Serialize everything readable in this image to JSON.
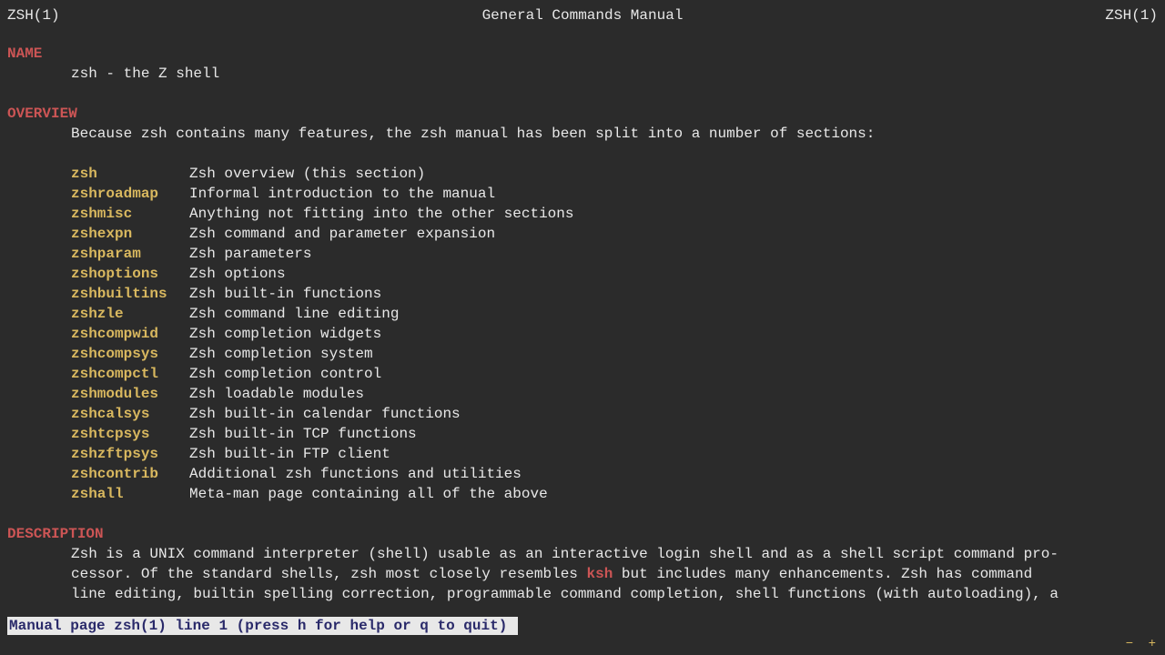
{
  "header": {
    "left": "ZSH(1)",
    "center": "General Commands Manual",
    "right": "ZSH(1)"
  },
  "name_section": {
    "header": "NAME",
    "line": "zsh - the Z shell"
  },
  "overview_section": {
    "header": "OVERVIEW",
    "intro": "Because zsh contains many features, the zsh manual has been split into a number of sections:",
    "items": [
      {
        "name": "zsh",
        "desc": "Zsh overview (this section)"
      },
      {
        "name": "zshroadmap",
        "desc": "Informal introduction to the manual"
      },
      {
        "name": "zshmisc",
        "desc": "Anything not fitting into the other sections"
      },
      {
        "name": "zshexpn",
        "desc": "Zsh command and parameter expansion"
      },
      {
        "name": "zshparam",
        "desc": "Zsh parameters"
      },
      {
        "name": "zshoptions",
        "desc": "Zsh options"
      },
      {
        "name": "zshbuiltins",
        "desc": "Zsh built-in functions"
      },
      {
        "name": "zshzle",
        "desc": "Zsh command line editing"
      },
      {
        "name": "zshcompwid",
        "desc": "Zsh completion widgets"
      },
      {
        "name": "zshcompsys",
        "desc": "Zsh completion system"
      },
      {
        "name": "zshcompctl",
        "desc": "Zsh completion control"
      },
      {
        "name": "zshmodules",
        "desc": "Zsh loadable modules"
      },
      {
        "name": "zshcalsys",
        "desc": "Zsh built-in calendar functions"
      },
      {
        "name": "zshtcpsys",
        "desc": "Zsh built-in TCP functions"
      },
      {
        "name": "zshzftpsys",
        "desc": "Zsh built-in FTP client"
      },
      {
        "name": "zshcontrib",
        "desc": "Additional zsh functions and utilities"
      },
      {
        "name": "zshall",
        "desc": "Meta-man page containing all of the above"
      }
    ]
  },
  "description_section": {
    "header": "DESCRIPTION",
    "line1": "Zsh  is  a UNIX command interpreter (shell) usable as an interactive login shell and as a shell script command pro‐",
    "line2a": "cessor.  Of the standard shells, zsh most closely resembles ",
    "ksh": "ksh",
    "line2b": " but includes many enhancements.   Zsh  has  command",
    "line3": "line  editing,  builtin spelling correction, programmable command completion, shell functions (with autoloading), a"
  },
  "status": " Manual page zsh(1) line 1 (press h for help or q to quit)",
  "icons": {
    "minus": "−",
    "plus": "+"
  }
}
